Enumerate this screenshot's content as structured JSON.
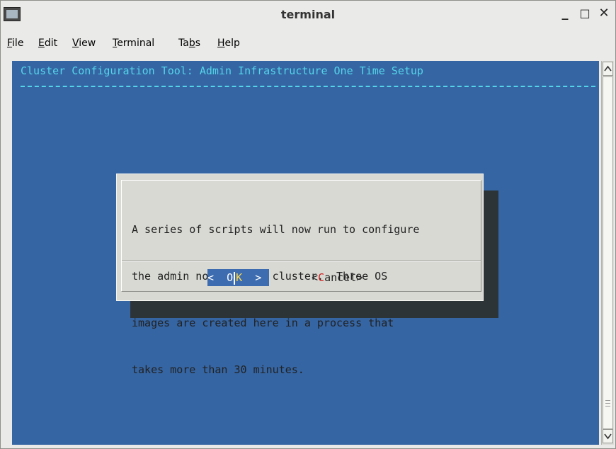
{
  "window": {
    "title": "terminal",
    "controls": {
      "minimize": "_",
      "maximize": "□",
      "close": "✕"
    }
  },
  "menubar": {
    "items": [
      {
        "underline": "F",
        "rest": "ile"
      },
      {
        "underline": "E",
        "rest": "dit"
      },
      {
        "underline": "V",
        "rest": "iew"
      },
      {
        "underline": "T",
        "rest": "erminal"
      },
      {
        "pre": "Ta",
        "underline": "b",
        "rest": "s"
      },
      {
        "underline": "H",
        "rest": "elp"
      }
    ]
  },
  "terminal": {
    "header": "Cluster Configuration Tool: Admin Infrastructure One Time Setup",
    "dialog": {
      "lines": [
        "A series of scripts will now run to configure",
        "the admin node of the cluster.  Three OS",
        "images are created here in a process that",
        "takes more than 30 minutes."
      ],
      "ok": {
        "left": "<  O",
        "hot": "K",
        "right": "  >"
      },
      "cancel": {
        "open": "<",
        "hot": "C",
        "rest": "ancel>"
      }
    },
    "colors": {
      "background": "#3565a3",
      "header": "#54d4e9",
      "dialog": "#d9d9d4",
      "selected_button": "#3d6cb0"
    }
  },
  "icons": {
    "app": "terminal-app-icon",
    "scroll_up": "chevron-up-icon",
    "scroll_down": "chevron-down-icon"
  }
}
